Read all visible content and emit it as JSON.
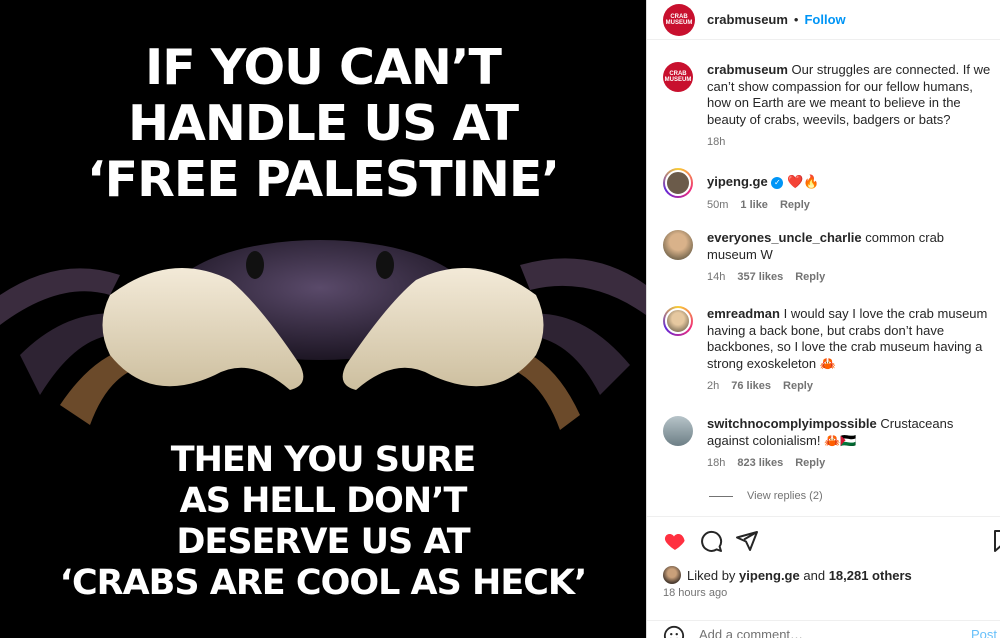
{
  "image": {
    "top_lines": [
      "IF YOU CAN’T",
      "HANDLE US AT",
      "‘FREE PALESTINE’"
    ],
    "bottom_lines": [
      "THEN YOU SURE",
      "AS HELL DON’T",
      "DESERVE US AT",
      "‘CRABS ARE COOL AS HECK’"
    ]
  },
  "header": {
    "username": "crabmuseum",
    "separator": "•",
    "follow_label": "Follow",
    "logo_text": "CRAB MUSEUM"
  },
  "caption": {
    "username": "crabmuseum",
    "text": "Our struggles are connected. If we can’t show compassion for our fellow humans, how on Earth are we meant to believe in the beauty of crabs, weevils, badgers or bats?",
    "time": "18h"
  },
  "comments": [
    {
      "username": "yipeng.ge",
      "text": "❤️🔥",
      "time": "50m",
      "likes": "1 like",
      "reply": "Reply"
    },
    {
      "username": "everyones_uncle_charlie",
      "text": "common crab museum W",
      "time": "14h",
      "likes": "357 likes",
      "reply": "Reply"
    },
    {
      "username": "emreadman",
      "text": "I would say I love the crab museum having a back bone, but crabs don’t have backbones, so I love the crab museum having a strong exoskeleton 🦀",
      "time": "2h",
      "likes": "76 likes",
      "reply": "Reply"
    },
    {
      "username": "switchnocomplyimpossible",
      "text": "Crustaceans against colonialism! 🦀🇵🇸",
      "time": "18h",
      "likes": "823 likes",
      "reply": "Reply"
    }
  ],
  "view_replies": "View replies (2)",
  "likes": {
    "prefix": "Liked by",
    "user": "yipeng.ge",
    "middle": "and",
    "others": "18,281 others"
  },
  "time_ago": "18 hours ago",
  "add_comment_placeholder": "Add a comment…",
  "post_label": "Post",
  "colors": {
    "accent": "#0095f6",
    "like_red": "#ff3040",
    "brand_red": "#c8102e"
  },
  "icons": [
    "heart-icon",
    "comment-icon",
    "share-icon",
    "save-icon",
    "emoji-icon",
    "verified-icon"
  ]
}
